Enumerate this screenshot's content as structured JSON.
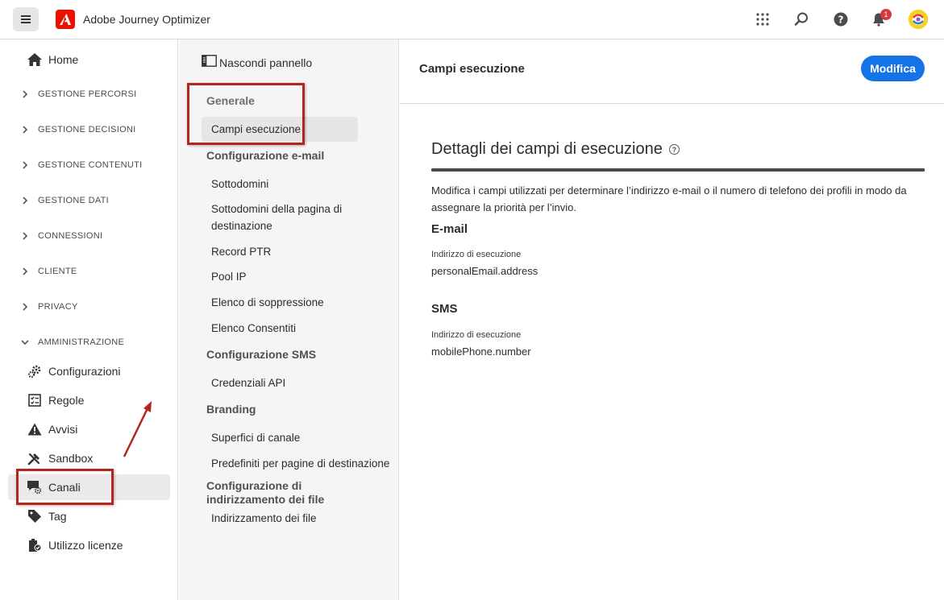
{
  "app": {
    "title": "Adobe Journey Optimizer",
    "notification_count": "1"
  },
  "icons": {
    "menu": "hamburger-icon",
    "logo": "adobe-logo-icon",
    "apps": "grid-icon",
    "search": "search-icon",
    "help": "help-icon",
    "bell": "bell-icon"
  },
  "leftnav": {
    "home": "Home",
    "sections": [
      "GESTIONE PERCORSI",
      "GESTIONE DECISIONI",
      "GESTIONE CONTENUTI",
      "GESTIONE DATI",
      "CONNESSIONI",
      "CLIENTE",
      "PRIVACY",
      "AMMINISTRAZIONE"
    ],
    "admin_items": [
      "Configurazioni",
      "Regole",
      "Avvisi",
      "Sandbox",
      "Canali",
      "Tag",
      "Utilizzo licenze"
    ]
  },
  "midpanel": {
    "hide_panel": "Nascondi pannello",
    "generale": "Generale",
    "campi_esecuzione": "Campi esecuzione",
    "config_email": "Configurazione e-mail",
    "email_items": [
      "Sottodomini",
      "Sottodomini della pagina di destinazione",
      "Record PTR",
      "Pool IP",
      "Elenco di soppressione",
      "Elenco Consentiti"
    ],
    "config_sms": "Configurazione SMS",
    "sms_items": [
      "Credenziali API"
    ],
    "branding": "Branding",
    "branding_items": [
      "Superfici di canale",
      "Predefiniti per pagine di destinazione"
    ],
    "config_indirizzamento": "Configurazione di indirizzamento dei file",
    "indirizzamento_items": [
      "Indirizzamento dei file"
    ]
  },
  "main": {
    "title": "Campi esecuzione",
    "edit_button": "Modifica",
    "details_title": "Dettagli dei campi di esecuzione",
    "help_glyph": "?",
    "description": "Modifica i campi utilizzati per determinare l’indirizzo e-mail o il numero di telefono dei profili in modo da assegnare la priorità per l’invio.",
    "email": {
      "title": "E-mail",
      "label": "Indirizzo di esecuzione",
      "value": "personalEmail.address"
    },
    "sms": {
      "title": "SMS",
      "label": "Indirizzo di esecuzione",
      "value": "mobilePhone.number"
    }
  },
  "colors": {
    "accent": "#1473e6",
    "brand": "#eb1000",
    "annotation": "#b3261e"
  }
}
